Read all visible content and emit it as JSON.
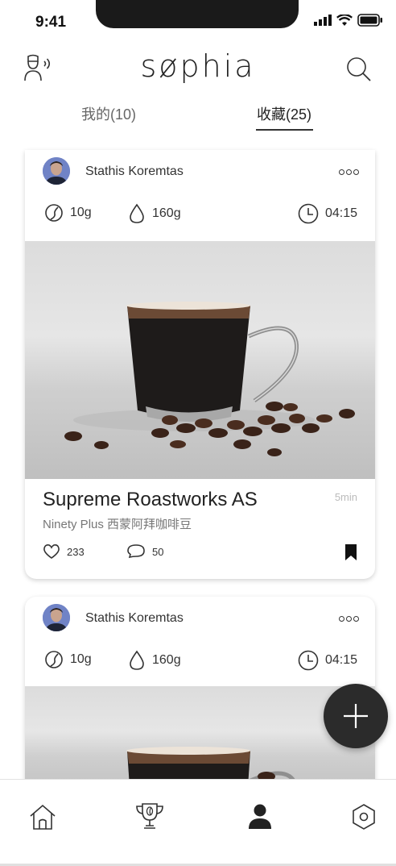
{
  "status_bar": {
    "time": "9:41"
  },
  "header": {
    "logo": "søphia",
    "left_icon": "barista-voice-icon",
    "right_icon": "search-icon"
  },
  "tabs": [
    {
      "label": "我的(10)",
      "active": false
    },
    {
      "label": "收藏(25)",
      "active": true
    }
  ],
  "cards": [
    {
      "author": "Stathis Koremtas",
      "stats": {
        "beans": "10g",
        "water": "160g",
        "time": "04:15"
      },
      "title": "Supreme Roastworks AS",
      "subtitle": "Ninety Plus 西蒙阿拜咖啡豆",
      "elapsed": "5min",
      "likes": "233",
      "comments": "50",
      "bookmarked": true
    },
    {
      "author": "Stathis Koremtas",
      "stats": {
        "beans": "10g",
        "water": "160g",
        "time": "04:15"
      }
    }
  ],
  "bottom_nav": [
    {
      "icon": "home-icon",
      "active": false
    },
    {
      "icon": "trophy-icon",
      "active": false
    },
    {
      "icon": "profile-icon",
      "active": true
    },
    {
      "icon": "settings-icon",
      "active": false
    }
  ],
  "colors": {
    "accent": "#2b2b2b",
    "muted": "#777777",
    "background": "#ffffff"
  }
}
